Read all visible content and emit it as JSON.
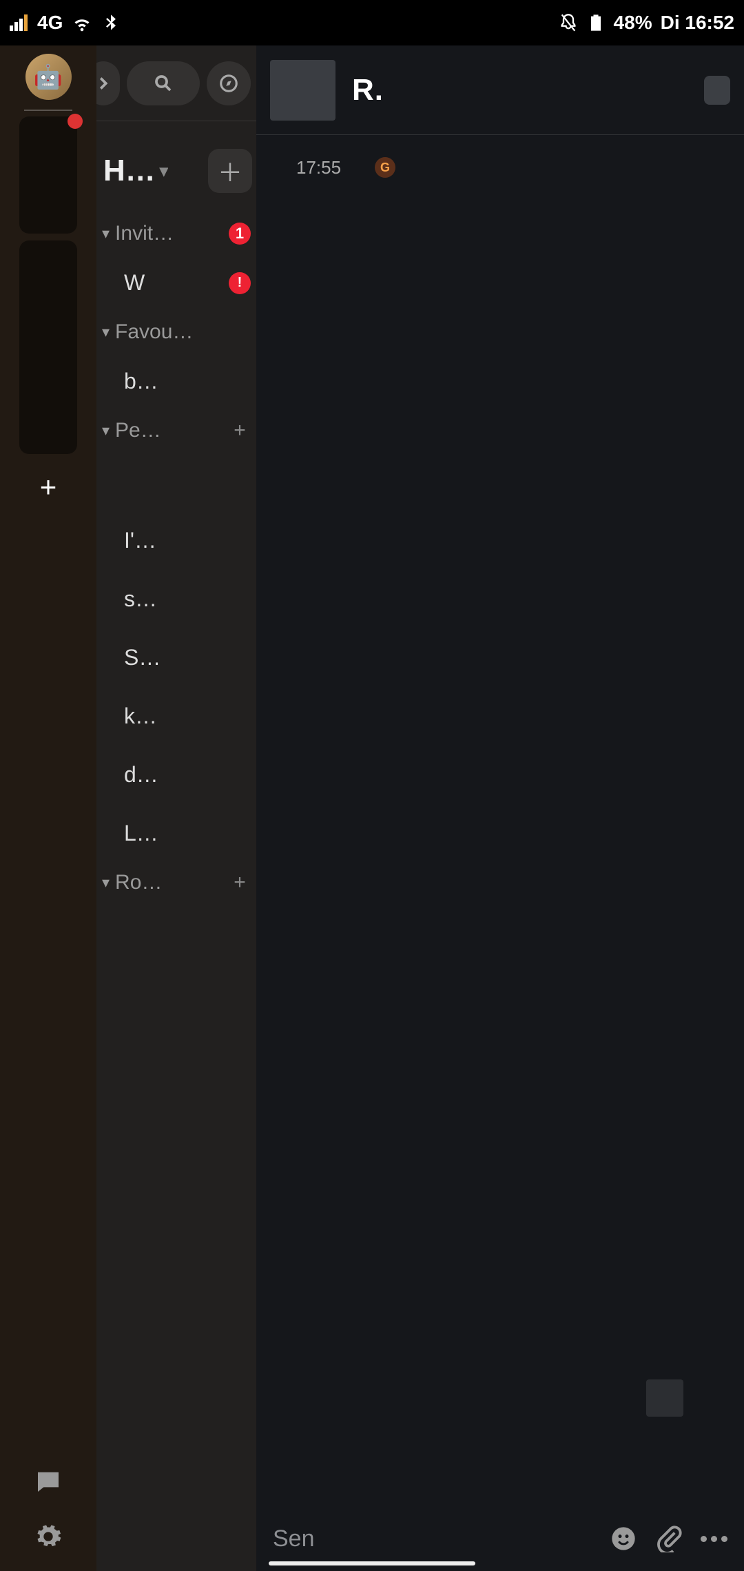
{
  "status": {
    "net": "4G",
    "battery": "48%",
    "time": "Di 16:52"
  },
  "space": {
    "title": "H…"
  },
  "sections": {
    "invites": {
      "label": "Invit…",
      "count": "1"
    },
    "favourites": {
      "label": "Favou…"
    },
    "people": {
      "label": "Pe…"
    },
    "rooms": {
      "label": "Ro…"
    }
  },
  "entries": {
    "invite_item": "W",
    "fav0": "b…",
    "p0": "I'…",
    "p1": "s…",
    "p2": "S…",
    "p3": "k…",
    "p4": "d…",
    "p5": "L…"
  },
  "chat": {
    "title": "R.",
    "msg_time": "17:55",
    "msg_badge": "G"
  },
  "composer": {
    "placeholder": "Sen"
  }
}
